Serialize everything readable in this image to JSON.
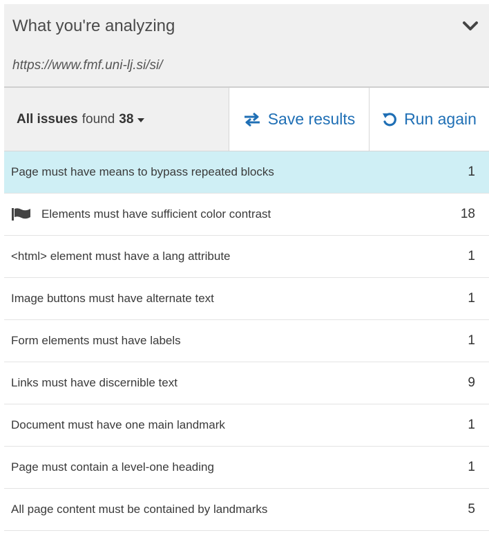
{
  "analyzing": {
    "title": "What you're analyzing",
    "url": "https://www.fmf.uni-lj.si/si/",
    "chevron_icon": "chevron-down-icon"
  },
  "toolbar": {
    "issues_label": "All issues",
    "found_label": "found",
    "issues_count": "38",
    "save_label": "Save results",
    "save_icon": "swap-arrows-icon",
    "run_label": "Run again",
    "run_icon": "rotate-icon"
  },
  "colors": {
    "accent": "#1f6fb5",
    "highlight_row": "#cfeff5",
    "header_bg": "#f0f0f0"
  },
  "issues": [
    {
      "label": "Page must have means to bypass repeated blocks",
      "count": "1",
      "highlighted": true,
      "flagged": false
    },
    {
      "label": "Elements must have sufficient color contrast",
      "count": "18",
      "highlighted": false,
      "flagged": true
    },
    {
      "label": "<html> element must have a lang attribute",
      "count": "1",
      "highlighted": false,
      "flagged": false
    },
    {
      "label": "Image buttons must have alternate text",
      "count": "1",
      "highlighted": false,
      "flagged": false
    },
    {
      "label": "Form elements must have labels",
      "count": "1",
      "highlighted": false,
      "flagged": false
    },
    {
      "label": "Links must have discernible text",
      "count": "9",
      "highlighted": false,
      "flagged": false
    },
    {
      "label": "Document must have one main landmark",
      "count": "1",
      "highlighted": false,
      "flagged": false
    },
    {
      "label": "Page must contain a level-one heading",
      "count": "1",
      "highlighted": false,
      "flagged": false
    },
    {
      "label": "All page content must be contained by landmarks",
      "count": "5",
      "highlighted": false,
      "flagged": false
    }
  ]
}
